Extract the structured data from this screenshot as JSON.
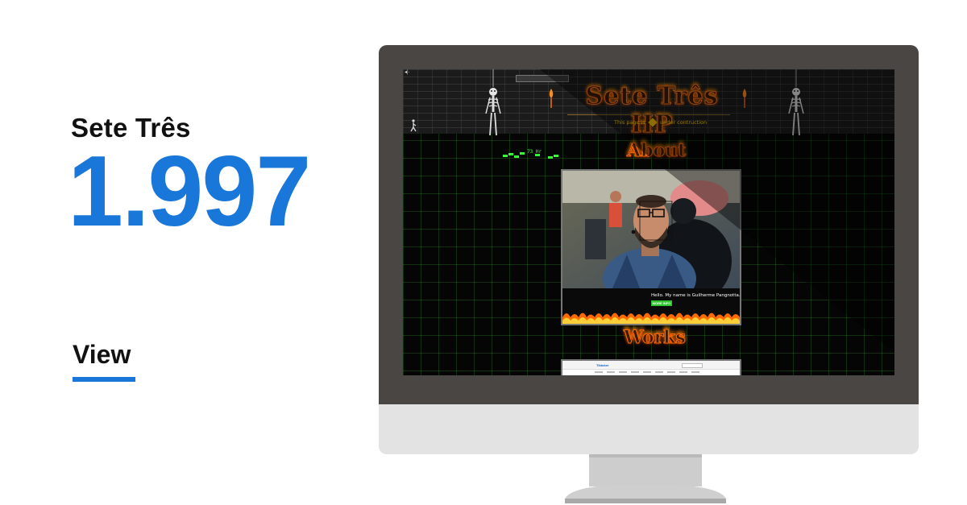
{
  "project": {
    "name": "Sete Três",
    "score": "1.997",
    "link_label": "View"
  },
  "site": {
    "back_label": "◂|·",
    "title": "Sete Três HP",
    "construction_prefix": "This page is",
    "construction_suffix": "under contruction",
    "counter_value": "73",
    "counter_suffix": "Hr",
    "about_heading": "About",
    "about_text": "Hello. My name is Guilherme Pangnotta. I'm a",
    "more_button": "MORE INFO",
    "works_heading": "Works",
    "works_logo": "Tiktoker"
  },
  "colors": {
    "accent": "#1877d9",
    "monitor_bezel": "#4a4643",
    "monitor_chin": "#e3e3e3",
    "grid_green": "#37ff37",
    "fire": "#ff6a00"
  },
  "icons": [
    "skeleton-icon",
    "torch-icon",
    "walking-figure-icon",
    "construction-sign-icon"
  ]
}
